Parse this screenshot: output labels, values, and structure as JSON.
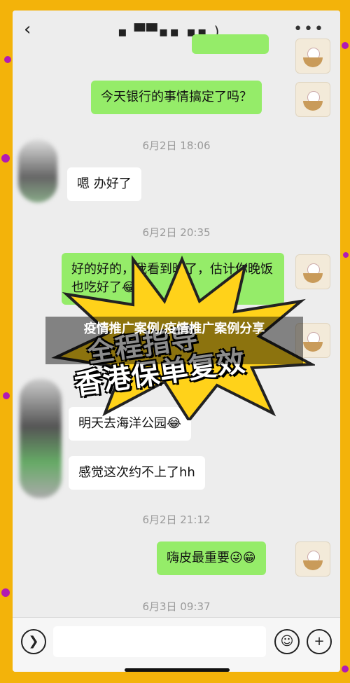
{
  "header": {
    "back_icon": "chevron-left-icon",
    "title": "▪ ▀▀▪▪ ▪▪ )",
    "more_icon": "more-dots-icon"
  },
  "messages": [
    {
      "type": "me",
      "text": "今天银行的事情搞定了吗？"
    },
    {
      "type": "time",
      "text": "6月2日 18:06"
    },
    {
      "type": "them",
      "text": "嗯 办好了"
    },
    {
      "type": "time",
      "text": "6月2日 20:35"
    },
    {
      "type": "me",
      "text": "好的好的，我看到晚了，估计你晚饭也吃好了😂"
    },
    {
      "type": "them",
      "text": "明天去海洋公园😂"
    },
    {
      "type": "them",
      "text": "感觉这次约不上了hh"
    },
    {
      "type": "time",
      "text": "6月2日 21:12"
    },
    {
      "type": "me",
      "text": "嗨皮最重要😜😁"
    },
    {
      "type": "time",
      "text": "6月3日 09:37"
    }
  ],
  "sticker": {
    "line1": "全程指导",
    "line2": "香港保单复效"
  },
  "overlay": {
    "banner": "疫情推广案例/疫情推广案例分享"
  },
  "bottom": {
    "voice_icon": "voice-icon",
    "emoji_icon": "emoji-icon",
    "plus_icon": "plus-icon"
  },
  "colors": {
    "frame": "#f3b30a",
    "dots": "#b21bb3",
    "bubble_me": "#95ec69",
    "bubble_them": "#ffffff"
  }
}
